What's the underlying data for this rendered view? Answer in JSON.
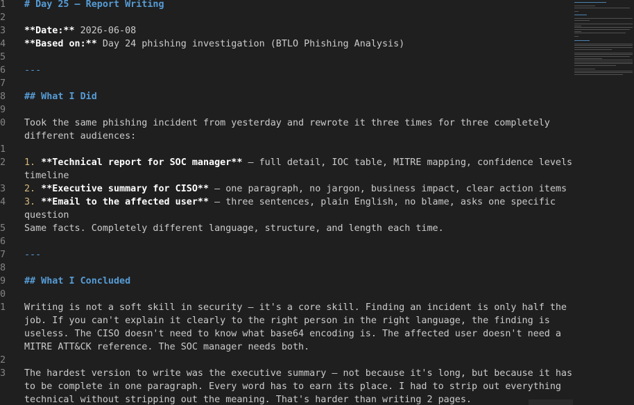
{
  "editor": {
    "lines": [
      {
        "n": "1",
        "parts": [
          {
            "c": "h1",
            "t": "# Day 25 — Report Writing"
          }
        ]
      },
      {
        "n": "2",
        "parts": []
      },
      {
        "n": "3",
        "parts": [
          {
            "c": "b",
            "t": "**Date:**"
          },
          {
            "c": "",
            "t": " 2026-06-08"
          }
        ]
      },
      {
        "n": "4",
        "parts": [
          {
            "c": "b",
            "t": "**Based on:**"
          },
          {
            "c": "",
            "t": " Day 24 phishing investigation (BTLO Phishing Analysis)"
          }
        ]
      },
      {
        "n": "5",
        "parts": []
      },
      {
        "n": "6",
        "parts": [
          {
            "c": "hr",
            "t": "---"
          }
        ]
      },
      {
        "n": "7",
        "parts": []
      },
      {
        "n": "8",
        "parts": [
          {
            "c": "h2",
            "t": "## What I Did"
          }
        ]
      },
      {
        "n": "9",
        "parts": []
      },
      {
        "n": "0",
        "parts": [
          {
            "c": "",
            "t": "Took the same phishing incident from yesterday and rewrote it three times for three completely"
          }
        ]
      },
      {
        "n": "",
        "parts": [
          {
            "c": "",
            "t": "different audiences:"
          }
        ]
      },
      {
        "n": "1",
        "parts": []
      },
      {
        "n": "2",
        "parts": [
          {
            "c": "num",
            "t": "1."
          },
          {
            "c": "",
            "t": " "
          },
          {
            "c": "b",
            "t": "**Technical report for SOC manager**"
          },
          {
            "c": "",
            "t": " — full detail, IOC table, MITRE mapping, confidence levels,"
          }
        ]
      },
      {
        "n": "",
        "parts": [
          {
            "c": "",
            "t": "timeline"
          }
        ]
      },
      {
        "n": "3",
        "parts": [
          {
            "c": "num",
            "t": "2."
          },
          {
            "c": "",
            "t": " "
          },
          {
            "c": "b",
            "t": "**Executive summary for CISO**"
          },
          {
            "c": "",
            "t": " — one paragraph, no jargon, business impact, clear action items"
          }
        ]
      },
      {
        "n": "4",
        "parts": [
          {
            "c": "num",
            "t": "3."
          },
          {
            "c": "",
            "t": " "
          },
          {
            "c": "b",
            "t": "**Email to the affected user**"
          },
          {
            "c": "",
            "t": " — three sentences, plain English, no blame, asks one specific"
          }
        ]
      },
      {
        "n": "",
        "parts": [
          {
            "c": "",
            "t": "question"
          }
        ]
      },
      {
        "n": "5",
        "parts": [
          {
            "c": "",
            "t": "Same facts. Completely different language, structure, and length each time."
          }
        ]
      },
      {
        "n": "6",
        "parts": []
      },
      {
        "n": "7",
        "parts": [
          {
            "c": "hr",
            "t": "---"
          }
        ]
      },
      {
        "n": "8",
        "parts": []
      },
      {
        "n": "9",
        "parts": [
          {
            "c": "h2",
            "t": "## What I Concluded"
          }
        ]
      },
      {
        "n": "0",
        "parts": []
      },
      {
        "n": "1",
        "parts": [
          {
            "c": "",
            "t": "Writing is not a soft skill in security — it's a core skill. Finding an incident is only half the"
          }
        ]
      },
      {
        "n": "",
        "parts": [
          {
            "c": "",
            "t": "job. If you can't explain it clearly to the right person in the right language, the finding is"
          }
        ]
      },
      {
        "n": "",
        "parts": [
          {
            "c": "",
            "t": "useless. The CISO doesn't need to know what base64 encoding is. The affected user doesn't need a"
          }
        ]
      },
      {
        "n": "",
        "parts": [
          {
            "c": "",
            "t": "MITRE ATT&CK reference. The SOC manager needs both."
          }
        ]
      },
      {
        "n": "2",
        "parts": []
      },
      {
        "n": "3",
        "parts": [
          {
            "c": "",
            "t": "The hardest version to write was the executive summary — not because it's long, but because it has"
          }
        ]
      },
      {
        "n": "",
        "parts": [
          {
            "c": "",
            "t": "to be complete in one paragraph. Every word has to earn its place. I had to strip out everything"
          }
        ]
      },
      {
        "n": "",
        "parts": [
          {
            "c": "",
            "t": "technical without stripping out the meaning. That's harder than writing 2 pages."
          }
        ]
      }
    ]
  },
  "colors": {
    "background": "#1f1f1f",
    "heading": "#569cd6",
    "list_number": "#d7ba7d",
    "bold_text": "#ffffff",
    "plain_text": "#cccccc",
    "line_number": "#858585"
  }
}
